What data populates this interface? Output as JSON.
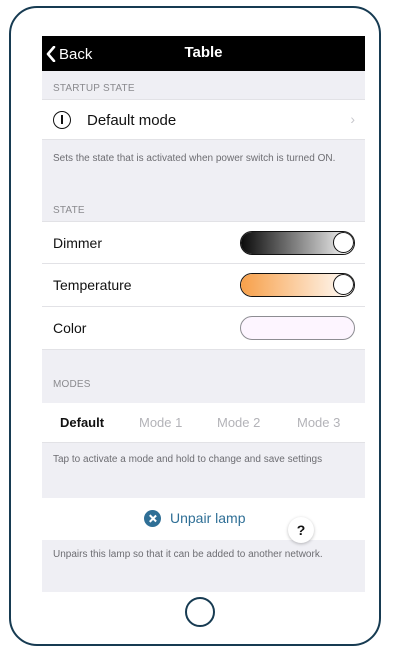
{
  "nav": {
    "back_label": "Back",
    "title": "Table"
  },
  "startup": {
    "header": "STARTUP STATE",
    "default_mode_label": "Default mode",
    "chevron": "›",
    "footnote": "Sets the state that is activated when power switch is turned ON."
  },
  "state": {
    "header": "STATE",
    "dimmer_label": "Dimmer",
    "dimmer_level": 1.0,
    "temperature_label": "Temperature",
    "temperature_level": 1.0,
    "color_label": "Color",
    "colors": {
      "dimmer_gradient_start": "#0a0a0a",
      "dimmer_gradient_end": "#ffffff",
      "temperature_gradient_start": "#f7a04a",
      "temperature_gradient_end": "#ffffff",
      "color_fill": "#fdf5ff"
    }
  },
  "modes": {
    "header": "MODES",
    "tabs": [
      "Default",
      "Mode 1",
      "Mode 2",
      "Mode 3"
    ],
    "active_tab": "Default",
    "footnote": "Tap to activate a mode and hold to change and save settings"
  },
  "unpair": {
    "label": "Unpair lamp",
    "footnote": "Unpairs this lamp so that it can be added to another network.",
    "accent": "#2f6f96"
  },
  "help": {
    "label": "?"
  },
  "icons": [
    "chevron-left-icon",
    "info-icon",
    "chevron-right-icon",
    "close-circle-icon"
  ]
}
